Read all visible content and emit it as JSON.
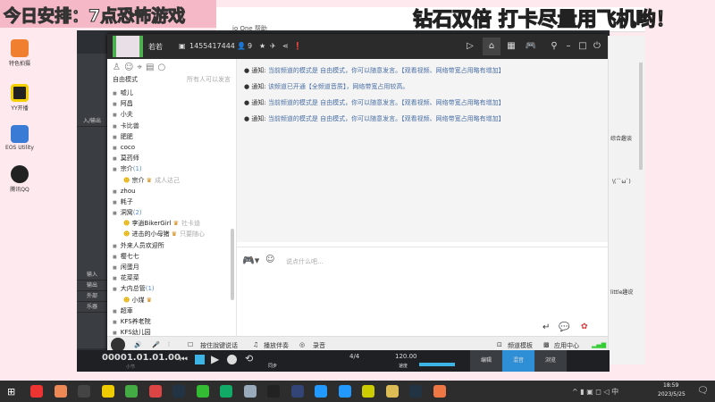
{
  "overlay": {
    "schedule": "今日安排：7点恐怖游戏",
    "promo": "钻石双倍 打卡尽量用飞机哟！"
  },
  "bg_window": {
    "menu": "io One 帮助"
  },
  "desktop": [
    {
      "label": "特色拍摄"
    },
    {
      "label": "YY开播"
    },
    {
      "label": "EOS Utility"
    },
    {
      "label": "腾讯QQ"
    }
  ],
  "daw": {
    "strip": [
      "输入",
      "输出",
      "外部",
      "乐器"
    ],
    "track_label": "入/输出",
    "time": "00001.01.01.00",
    "time_unit": "小节",
    "signature": "4/4",
    "tempo": "120.00",
    "sync": "同步",
    "tempo_label": "速度",
    "modes": [
      "编辑",
      "混音",
      "浏览"
    ]
  },
  "yy": {
    "channel_name": "若若",
    "channel_id": "1455417444",
    "online": "9",
    "mode": "自由模式",
    "mode_hint": "所有人可以发言",
    "members": [
      {
        "name": "嘘儿"
      },
      {
        "name": "阿昌"
      },
      {
        "name": "小夫"
      },
      {
        "name": "卡比兽"
      },
      {
        "name": "肥肥"
      },
      {
        "name": "coco"
      },
      {
        "name": "莫药师"
      },
      {
        "name": "宗介",
        "count": "(1)",
        "children": [
          {
            "name": "宗介",
            "tag": "成人达己"
          }
        ]
      },
      {
        "name": "zhou"
      },
      {
        "name": "耗子"
      },
      {
        "name": "洞窝",
        "count": "(2)",
        "children": [
          {
            "name": "李逍BikerGirl",
            "tag": "社卡迪"
          },
          {
            "name": "进击的小母猪",
            "tag": "只要随心"
          }
        ]
      },
      {
        "name": "外来人员欢迎所"
      },
      {
        "name": "樱七七"
      },
      {
        "name": "闲蛋月"
      },
      {
        "name": "花菜菜"
      },
      {
        "name": "大内总管",
        "count": "(1)",
        "children": [
          {
            "name": "小煤",
            "tag": ""
          }
        ]
      },
      {
        "name": "超車"
      }
    ],
    "groups": [
      {
        "name": "KFS养老院"
      },
      {
        "name": "KFS幼儿园"
      }
    ],
    "messages": [
      {
        "prefix": "通知:",
        "text": "当前频道的模式是 自由模式，你可以随意发言。【观看视频、网络带宽占用略有增加】"
      },
      {
        "prefix": "通知:",
        "text": "该频道已开通【全频道音质】，网络带宽占用较高。"
      },
      {
        "prefix": "通知:",
        "text": "当前频道的模式是 自由模式，你可以随意发言。【观看视频、网络带宽占用略有增加】"
      },
      {
        "prefix": "通知:",
        "text": "当前频道的模式是 自由模式，你可以随意发言。【观看视频、网络带宽占用略有增加】"
      }
    ],
    "input_placeholder": "说点什么吧...",
    "bottom": {
      "ptt": "按住說键说话",
      "music": "播放伴奏",
      "record": "录音",
      "template": "频道模板",
      "apps": "应用中心"
    }
  },
  "right_panel": {
    "items": [
      "综合趣谈",
      "\\(ˊ`ω`)",
      "little趣说"
    ]
  },
  "clock": {
    "time": "18:59",
    "date": "2023/5/25"
  }
}
